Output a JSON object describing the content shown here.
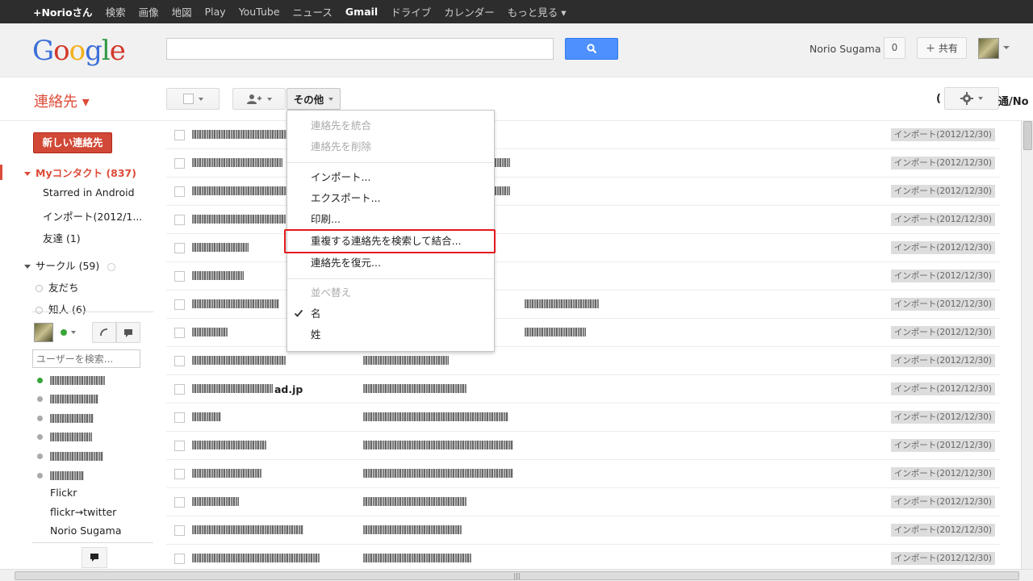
{
  "gbar": {
    "items": [
      "+Norioさん",
      "検索",
      "画像",
      "地図",
      "Play",
      "YouTube",
      "ニュース",
      "Gmail",
      "ドライブ",
      "カレンダー",
      "もっと見る ▾"
    ]
  },
  "header": {
    "logo": "Google",
    "user_name": "Norio Sugama",
    "notifications": "0",
    "share_label": "共有"
  },
  "toolbar": {
    "app_title": "連絡先 ▾",
    "more_label": "その他",
    "right_label": "(",
    "right_label2": "通/No"
  },
  "sidebar": {
    "new_contact": "新しい連絡先",
    "my_contacts": "Myコンタクト (837)",
    "starred": "Starred in Android",
    "imported": "インポート(2012/1...",
    "friends": "友達 (1)",
    "circles": "サークル (59)",
    "circle_friends": "友だち",
    "circle_acq": "知人 (6)",
    "user_search_placeholder": "ユーザーを検索...",
    "chat_plain": [
      "Flickr",
      "flickr→twitter",
      "Norio Sugama"
    ]
  },
  "menu": {
    "items": [
      {
        "label": "連絡先を統合",
        "disabled": true
      },
      {
        "label": "連絡先を削除",
        "disabled": true
      },
      {
        "label": "インポート...",
        "disabled": false
      },
      {
        "label": "エクスポート...",
        "disabled": false
      },
      {
        "label": "印刷...",
        "disabled": false
      },
      {
        "label": "重複する連絡先を検索して結合...",
        "disabled": false
      },
      {
        "label": "連絡先を復元...",
        "disabled": false
      },
      {
        "label": "並べ替え",
        "disabled": true
      },
      {
        "label": "名",
        "disabled": false
      },
      {
        "label": "姓",
        "disabled": false
      }
    ]
  },
  "list": {
    "badge": "インポート(2012/12/30)",
    "bold_name": "ad.jp"
  },
  "scroll": {
    "h_thumb": "|||"
  },
  "colors": {
    "accent_red": "#dd4b39",
    "search_blue": "#4d90fe",
    "highlight": "#e3191b"
  }
}
